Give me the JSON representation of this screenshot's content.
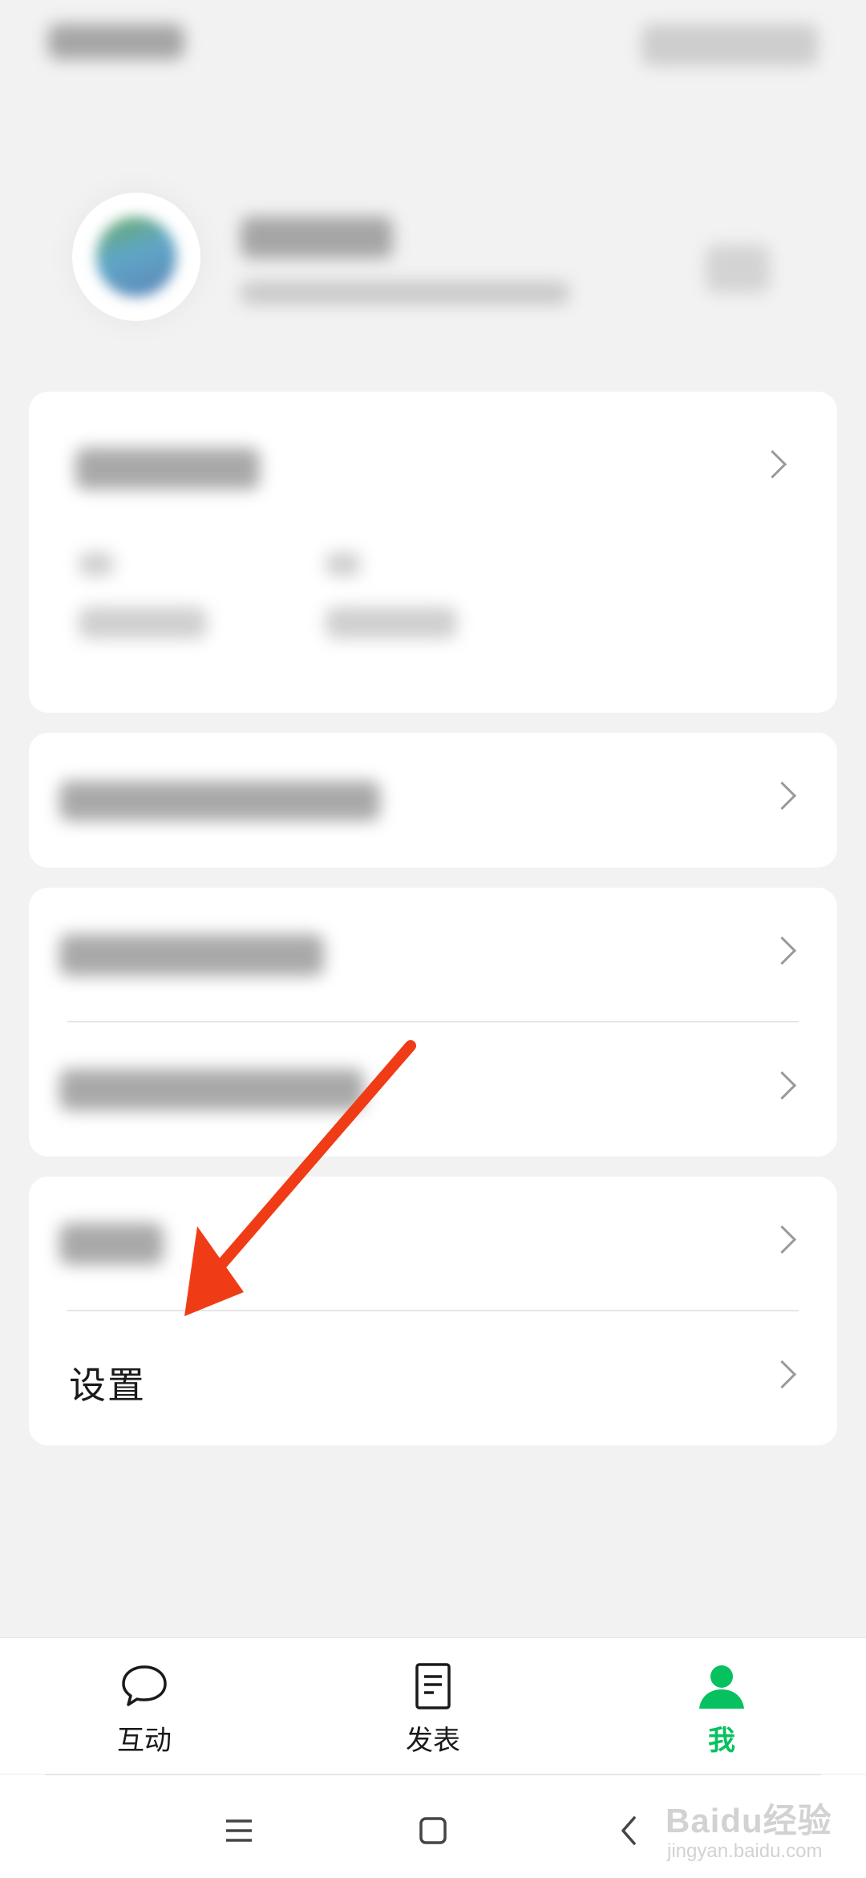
{
  "menu": {
    "settings_label": "设置"
  },
  "tabbar": {
    "tabs": [
      {
        "label": "互动",
        "icon": "chat-bubble-icon",
        "active": false
      },
      {
        "label": "发表",
        "icon": "document-icon",
        "active": false
      },
      {
        "label": "我",
        "icon": "person-icon",
        "active": true
      }
    ]
  },
  "colors": {
    "accent_green": "#07c160",
    "annotation_red": "#f03c16"
  },
  "watermark": {
    "main": "Baidu经验",
    "sub": "jingyan.baidu.com"
  }
}
